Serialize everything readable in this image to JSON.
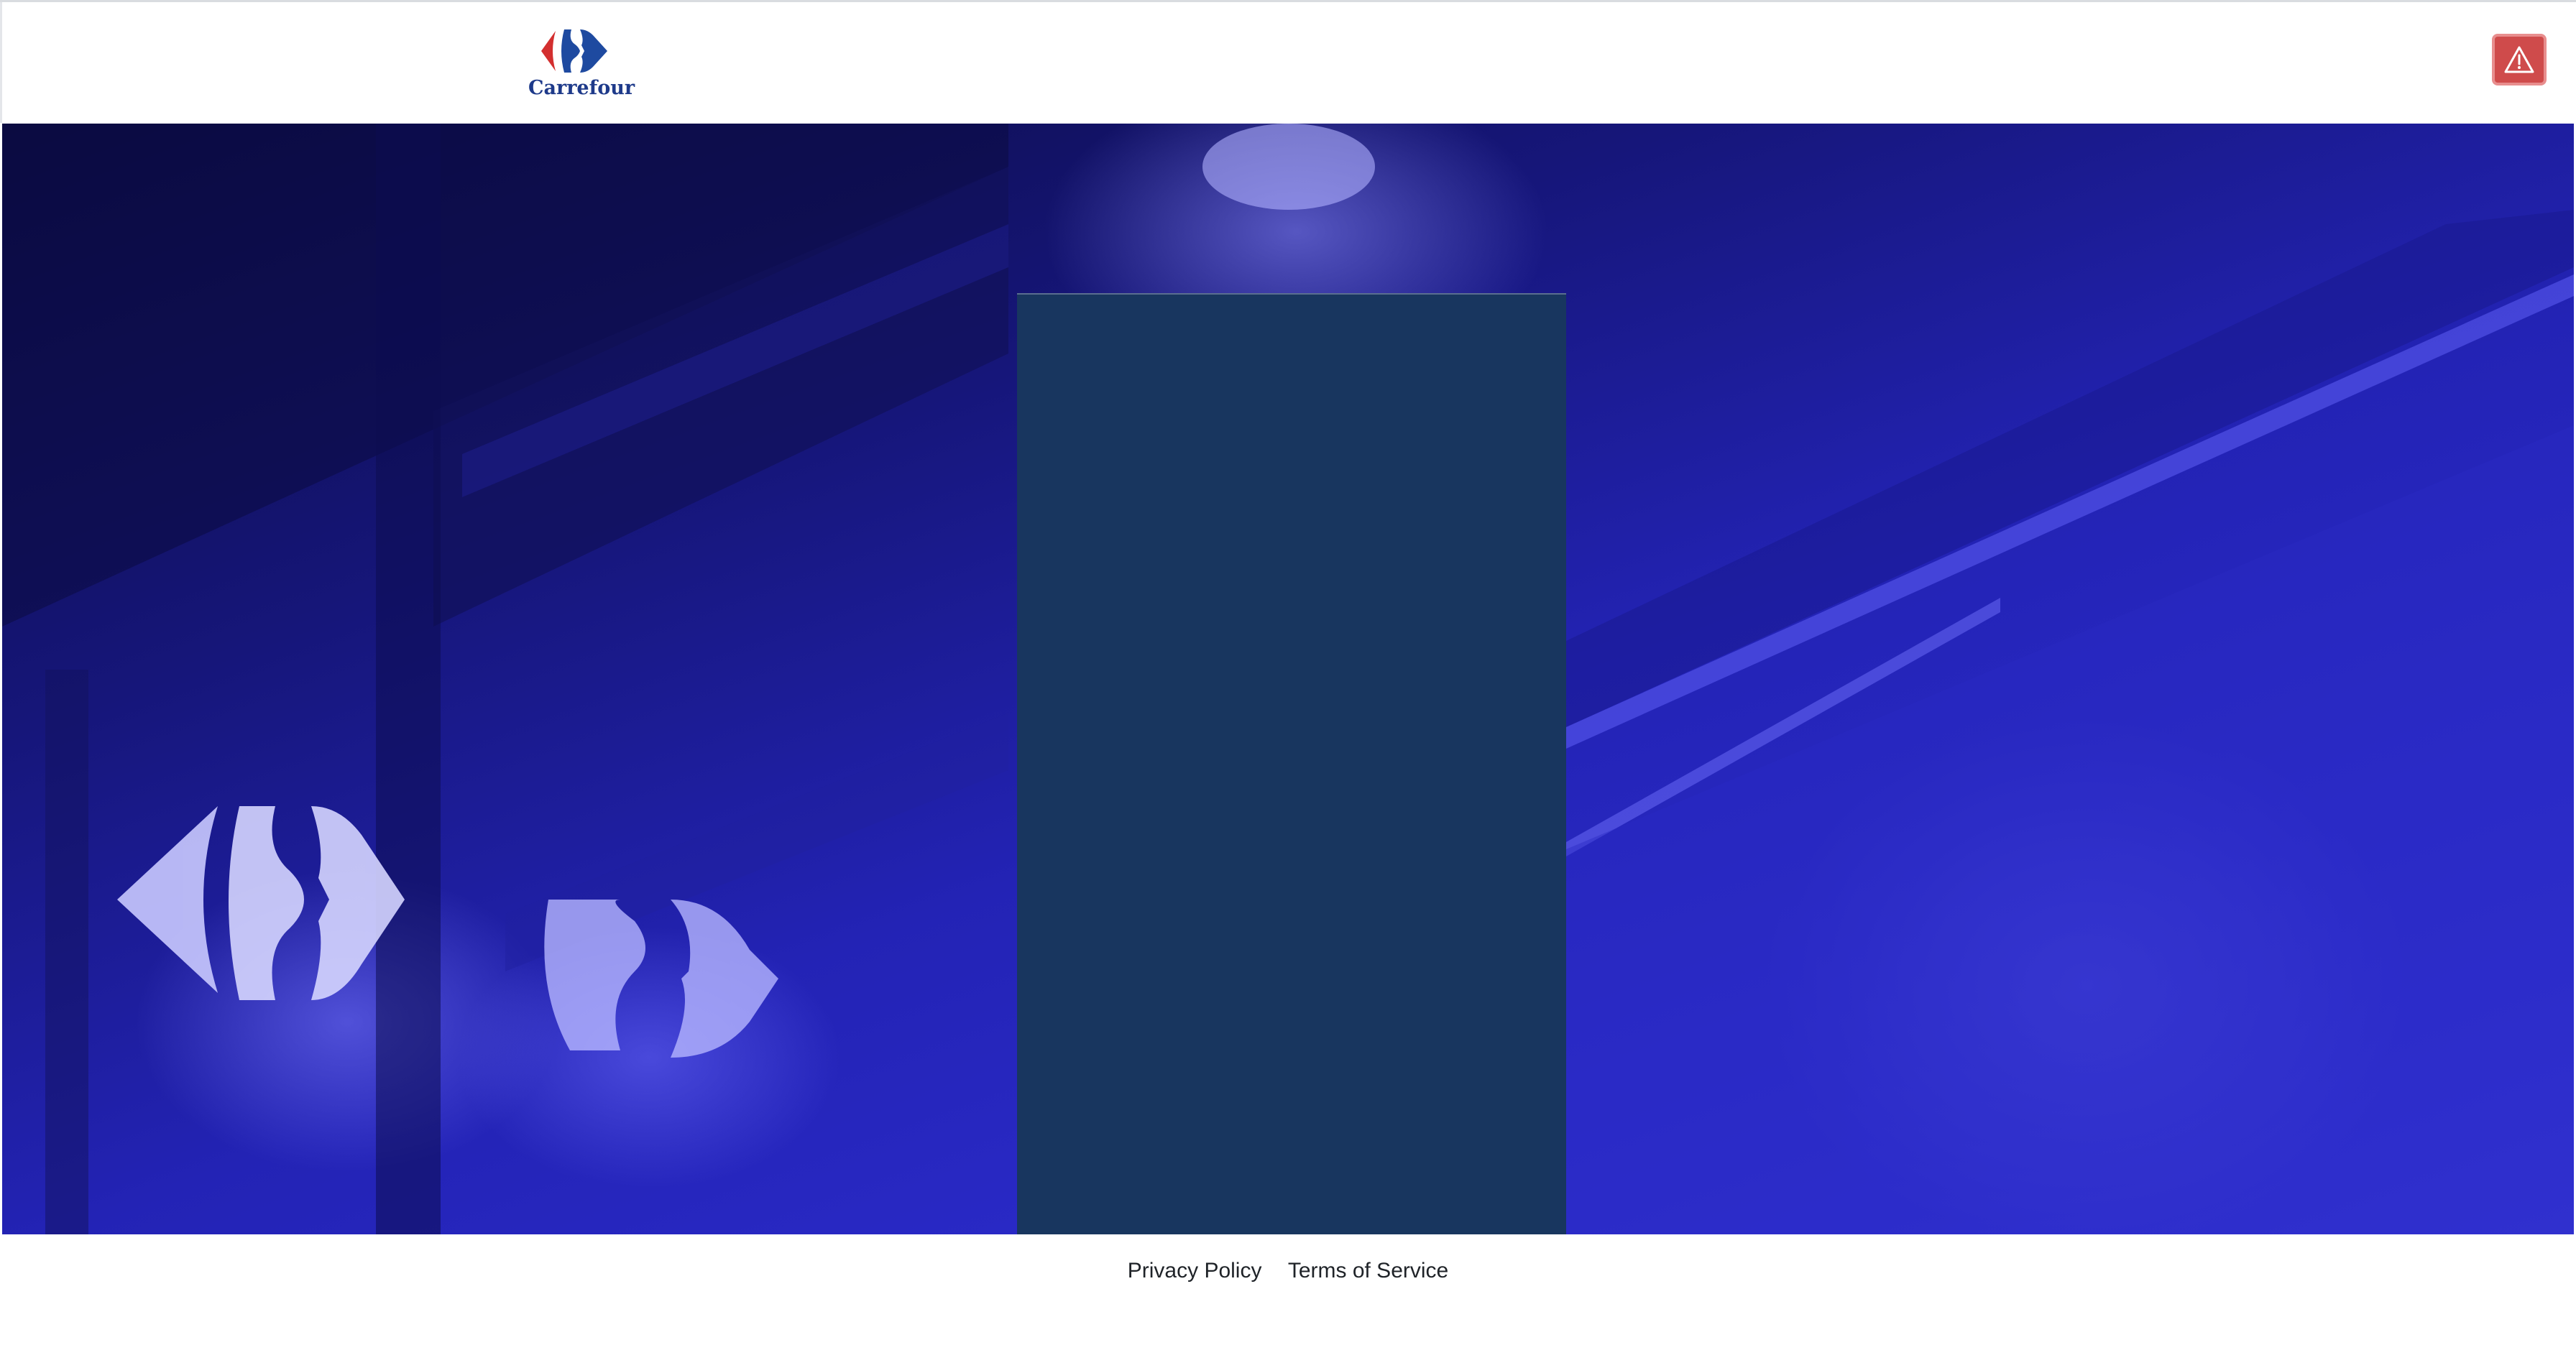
{
  "header": {
    "logo_text": "Carrefour",
    "alert_icon": "warning-icon"
  },
  "colors": {
    "brand_blue": "#1e3a8a",
    "brand_red": "#d32f2f",
    "alert_bg": "#cf4b4b",
    "panel_bg": "#18365f"
  },
  "footer": {
    "links": [
      "Privacy Policy",
      "Terms of Service"
    ]
  }
}
